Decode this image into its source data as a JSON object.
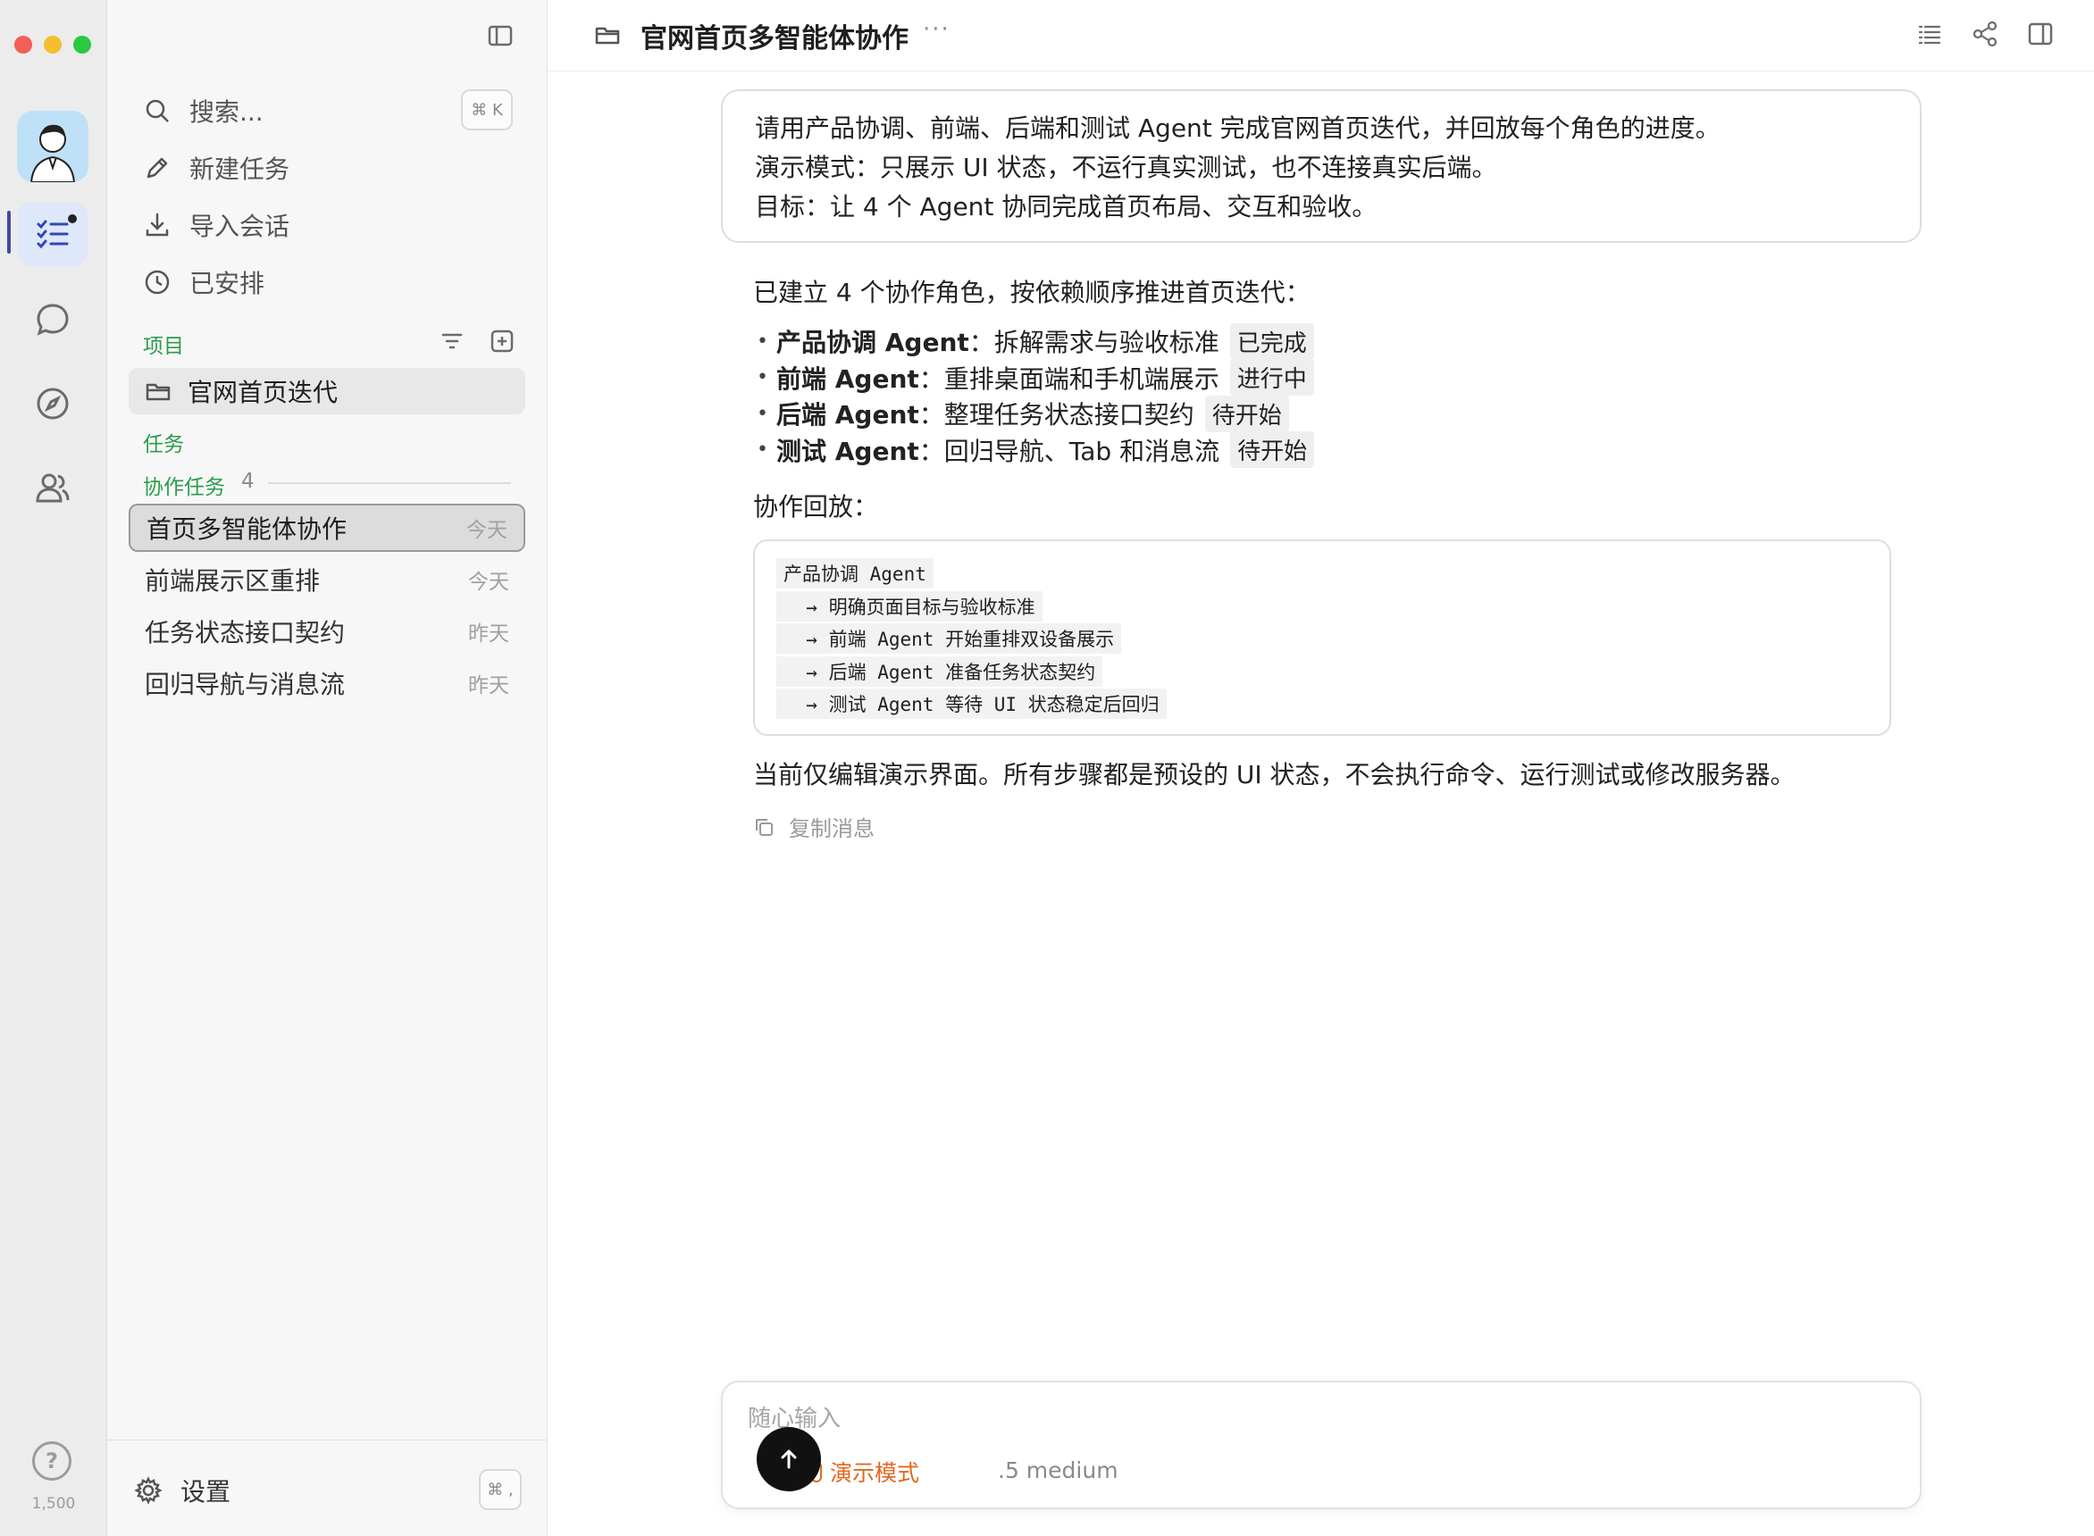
{
  "rail": {
    "count": "1,500"
  },
  "sidebar": {
    "search_label": "搜索...",
    "search_shortcut": "⌘ K",
    "nav": [
      {
        "label": "新建任务"
      },
      {
        "label": "导入会话"
      },
      {
        "label": "已安排"
      }
    ],
    "projects_label": "项目",
    "project_name": "官网首页迭代",
    "tasks_label": "任务",
    "collab_label": "协作任务",
    "collab_count": "4",
    "tasks": [
      {
        "title": "首页多智能体协作",
        "time": "今天"
      },
      {
        "title": "前端展示区重排",
        "time": "今天"
      },
      {
        "title": "任务状态接口契约",
        "time": "昨天"
      },
      {
        "title": "回归导航与消息流",
        "time": "昨天"
      }
    ],
    "settings_label": "设置",
    "settings_shortcut": "⌘ ,"
  },
  "header": {
    "title": "官网首页多智能体协作",
    "more": "···"
  },
  "conversation": {
    "user_lines": [
      "请用产品协调、前端、后端和测试 Agent 完成官网首页迭代，并回放每个角色的进度。",
      "演示模式：只展示 UI 状态，不运行真实测试，也不连接真实后端。",
      "目标：让 4 个 Agent 协同完成首页布局、交互和验收。"
    ],
    "intro": "已建立 4 个协作角色，按依赖顺序推进首页迭代：",
    "agents": [
      {
        "name": "产品协调 Agent",
        "task": "：拆解需求与验收标准",
        "status": "已完成"
      },
      {
        "name": "前端 Agent",
        "task": "：重排桌面端和手机端展示",
        "status": "进行中"
      },
      {
        "name": "后端 Agent",
        "task": "：整理任务状态接口契约",
        "status": "待开始"
      },
      {
        "name": "测试 Agent",
        "task": "：回归导航、Tab 和消息流",
        "status": "待开始"
      }
    ],
    "replay_label": "协作回放：",
    "code_lines": [
      "产品协调 Agent",
      "  → 明确页面目标与验收标准",
      "  → 前端 Agent 开始重排双设备展示",
      "  → 后端 Agent 准备任务状态契约",
      "  → 测试 Agent 等待 UI 状态稳定后回归"
    ],
    "note": "当前仅编辑演示界面。所有步骤都是预设的 UI 状态，不会执行命令、运行测试或修改服务器。",
    "copy_label": "复制消息"
  },
  "composer": {
    "placeholder": "随心输入",
    "mode": "演示模式",
    "model": ".5 medium"
  },
  "colors": {
    "accent_green": "#2a9d4b",
    "demo_orange": "#e3681f",
    "send_button": "#111111"
  }
}
